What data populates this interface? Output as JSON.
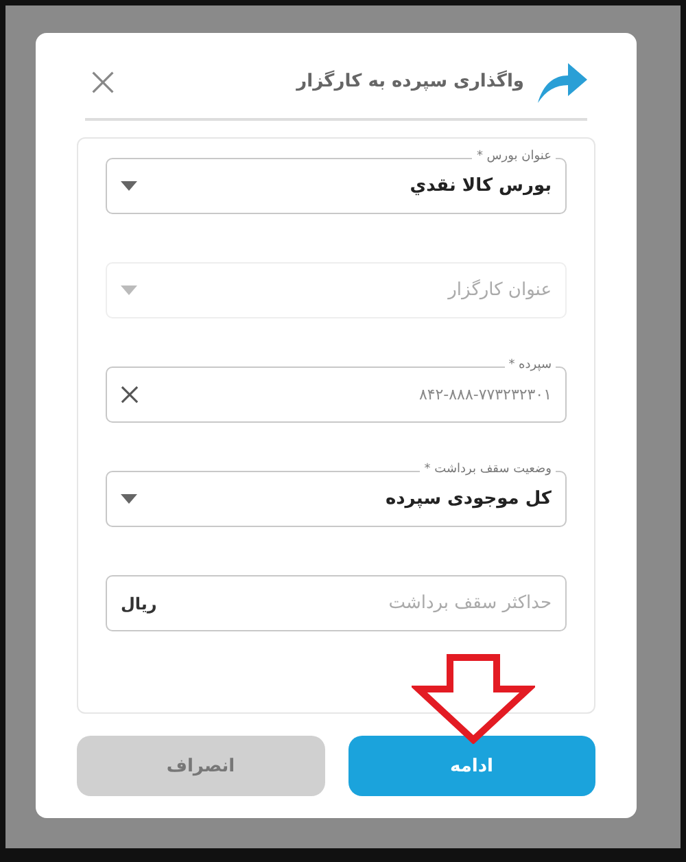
{
  "dialog": {
    "title": "واگذاری سپرده به کارگزار"
  },
  "fields": [
    {
      "kind": "select",
      "label": "عنوان بورس *",
      "value": "بورس کالا نقدي",
      "disabled": false
    },
    {
      "kind": "select",
      "placeholder": "عنوان کارگزار",
      "disabled": true
    },
    {
      "kind": "text",
      "label": "سپرده *",
      "value": "۸۴۲-۸۸۸-۷۷۳۲۳۲۳۰۱",
      "clearable": true,
      "disabled": false
    },
    {
      "kind": "select",
      "label": "وضعیت سقف برداشت *",
      "value": "کل موجودی سپرده",
      "disabled": false
    },
    {
      "kind": "amount",
      "placeholder": "حداکثر سقف برداشت",
      "suffix": "ریال",
      "disabled": false
    }
  ],
  "buttons": [
    {
      "label": "ادامه",
      "kind": "primary"
    },
    {
      "label": "انصراف",
      "kind": "secondary"
    }
  ]
}
